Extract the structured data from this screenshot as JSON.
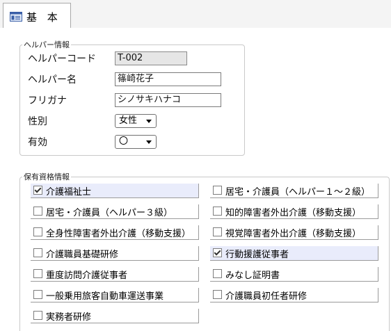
{
  "tab": {
    "label": "基 本",
    "icon": "form-icon"
  },
  "helper_group": {
    "title": "ヘルパー情報",
    "code_label": "ヘルパーコード",
    "code_value": "T-002",
    "name_label": "ヘルパー名",
    "name_value": "篠崎花子",
    "kana_label": "フリガナ",
    "kana_value": "シノサキハナコ",
    "gender_label": "性別",
    "gender_value": "女性",
    "active_label": "有効",
    "active_value": "〇"
  },
  "qual_group": {
    "title": "保有資格情報",
    "items": [
      {
        "label": "介護福祉士",
        "checked": true
      },
      {
        "label": "居宅・介護員（ヘルパー１～２級）",
        "checked": false
      },
      {
        "label": "居宅・介護員（ヘルパー３級）",
        "checked": false
      },
      {
        "label": "知的障害者外出介護（移動支援）",
        "checked": false
      },
      {
        "label": "全身性障害者外出介護（移動支援）",
        "checked": false
      },
      {
        "label": "視覚障害者外出介護（移動支援）",
        "checked": false
      },
      {
        "label": "介護職員基礎研修",
        "checked": false
      },
      {
        "label": "行動援護従事者",
        "checked": true
      },
      {
        "label": "重度訪問介護従事者",
        "checked": false
      },
      {
        "label": "みなし証明書",
        "checked": false
      },
      {
        "label": "一般乗用旅客自動車運送事業",
        "checked": false
      },
      {
        "label": "介護職員初任者研修",
        "checked": false
      },
      {
        "label": "実務者研修",
        "checked": false
      }
    ]
  }
}
